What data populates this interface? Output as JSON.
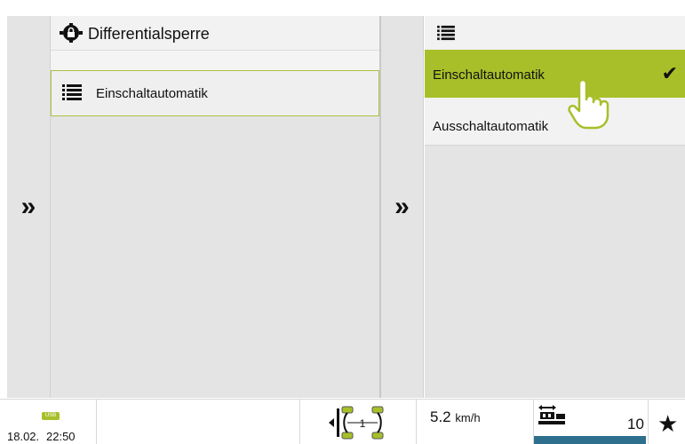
{
  "main_panel": {
    "title": "Differentialsperre",
    "icon": "differential-lock-icon",
    "item_label": "Einschaltautomatik",
    "item_icon": "list-icon"
  },
  "right_panel": {
    "header_icon": "list-icon",
    "options": [
      {
        "label": "Einschaltautomatik",
        "selected": true
      },
      {
        "label": "Ausschaltautomatik",
        "selected": false
      }
    ],
    "check_glyph": "✔"
  },
  "nav": {
    "expand_glyph": "»"
  },
  "status_bar": {
    "usb_label": "USB",
    "date": "18.02.",
    "time": "22:50",
    "speed_value": "5.2",
    "speed_unit": "km/h",
    "steering_number": "1",
    "count": "10",
    "star_glyph": "★"
  },
  "colors": {
    "accent_green": "#a8bf2a",
    "panel_gray": "#e4e4e4",
    "status_blue": "#2e6f8e"
  }
}
